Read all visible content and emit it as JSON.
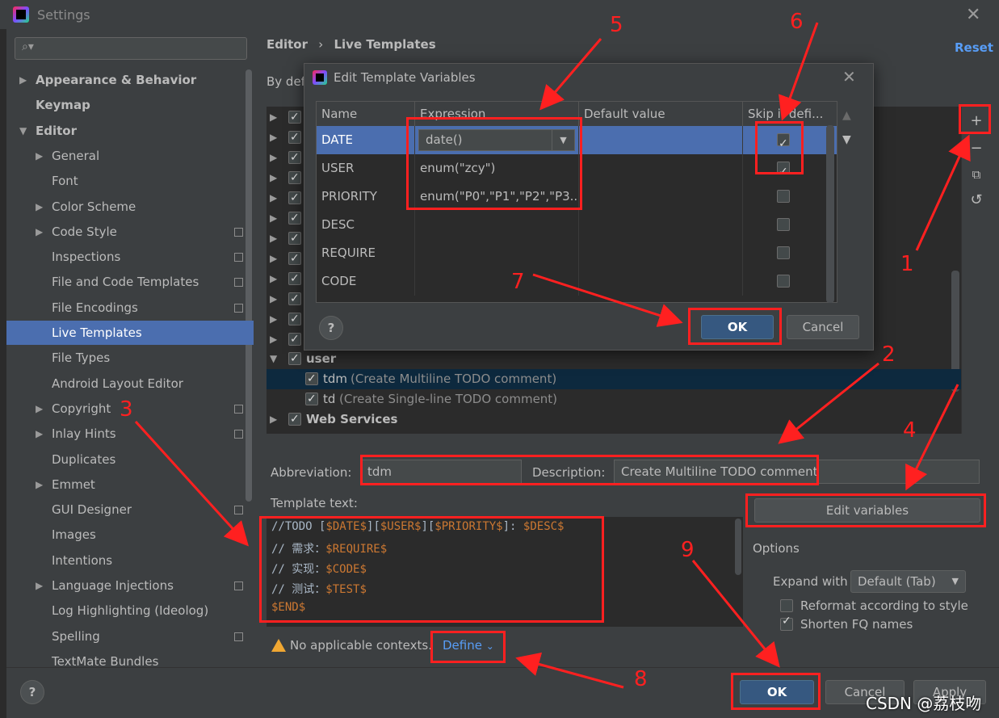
{
  "window": {
    "title": "Settings"
  },
  "sidebar": {
    "search_placeholder": "",
    "items": [
      {
        "label": "Appearance & Behavior",
        "bold": true,
        "arrow": "▶"
      },
      {
        "label": "Keymap",
        "bold": true,
        "arrow": ""
      },
      {
        "label": "Editor",
        "bold": true,
        "arrow": "▼"
      },
      {
        "label": "General",
        "arrow": "▶"
      },
      {
        "label": "Font",
        "arrow": ""
      },
      {
        "label": "Color Scheme",
        "arrow": "▶"
      },
      {
        "label": "Code Style",
        "arrow": "▶",
        "proj": true
      },
      {
        "label": "Inspections",
        "arrow": "",
        "proj": true
      },
      {
        "label": "File and Code Templates",
        "arrow": "",
        "proj": true
      },
      {
        "label": "File Encodings",
        "arrow": "",
        "proj": true
      },
      {
        "label": "Live Templates",
        "arrow": "",
        "selected": true
      },
      {
        "label": "File Types",
        "arrow": ""
      },
      {
        "label": "Android Layout Editor",
        "arrow": ""
      },
      {
        "label": "Copyright",
        "arrow": "▶",
        "proj": true
      },
      {
        "label": "Inlay Hints",
        "arrow": "▶",
        "proj": true
      },
      {
        "label": "Duplicates",
        "arrow": ""
      },
      {
        "label": "Emmet",
        "arrow": "▶"
      },
      {
        "label": "GUI Designer",
        "arrow": "",
        "proj": true
      },
      {
        "label": "Images",
        "arrow": ""
      },
      {
        "label": "Intentions",
        "arrow": ""
      },
      {
        "label": "Language Injections",
        "arrow": "▶",
        "proj": true
      },
      {
        "label": "Log Highlighting (Ideolog)",
        "arrow": ""
      },
      {
        "label": "Spelling",
        "arrow": "",
        "proj": true
      },
      {
        "label": "TextMate Bundles",
        "arrow": ""
      }
    ]
  },
  "main": {
    "breadcrumb_root": "Editor",
    "breadcrumb_sep": "›",
    "breadcrumb_leaf": "Live Templates",
    "reset": "Reset",
    "by_default": "By def",
    "toolbar": {
      "add": "+",
      "remove": "−",
      "copy": "⧉",
      "restore": "↺"
    },
    "groups": [
      {
        "label": "user",
        "expanded": true
      },
      {
        "label": "Web Services",
        "expanded": false
      }
    ],
    "templates": [
      {
        "abbr": "tdm",
        "desc": "(Create Multiline TODO comment)"
      },
      {
        "abbr": "td",
        "desc": "(Create Single-line TODO comment)"
      }
    ],
    "abbreviation_label": "Abbreviation:",
    "abbreviation_value": "tdm",
    "description_label": "Description:",
    "description_value": "Create Multiline TODO comment",
    "template_text_label": "Template text:",
    "template_lines": [
      [
        {
          "t": "//TODO ["
        },
        {
          "t": "$DATE$",
          "v": true
        },
        {
          "t": "]["
        },
        {
          "t": "$USER$",
          "v": true
        },
        {
          "t": "]["
        },
        {
          "t": "$PRIORITY$",
          "v": true
        },
        {
          "t": "]: "
        },
        {
          "t": "$DESC$",
          "v": true
        }
      ],
      [
        {
          "t": "// 需求："
        },
        {
          "t": "$REQUIRE$",
          "v": true
        }
      ],
      [
        {
          "t": "// 实现："
        },
        {
          "t": "$CODE$",
          "v": true
        }
      ],
      [
        {
          "t": "// 测试："
        },
        {
          "t": "$TEST$",
          "v": true
        }
      ],
      [
        {
          "t": "$END$",
          "v": true
        }
      ]
    ],
    "edit_variables": "Edit variables",
    "options_label": "Options",
    "expand_with_label": "Expand with",
    "expand_with_value": "Default (Tab)",
    "reformat_label": "Reformat according to style",
    "shorten_label": "Shorten FQ names",
    "contexts_warning": "No applicable contexts.",
    "define": "Define",
    "chevron": "⌄"
  },
  "footer": {
    "help": "?",
    "ok": "OK",
    "cancel": "Cancel",
    "apply": "Apply"
  },
  "dialog": {
    "title": "Edit Template Variables",
    "columns": [
      "Name",
      "Expression",
      "Default value",
      "Skip if defi..."
    ],
    "rows": [
      {
        "name": "DATE",
        "expression": "date()",
        "default": "",
        "skip": true,
        "selected": true
      },
      {
        "name": "USER",
        "expression": "enum(\"zcy\")",
        "default": "",
        "skip": true
      },
      {
        "name": "PRIORITY",
        "expression": "enum(\"P0\",\"P1\",\"P2\",\"P3...",
        "default": "",
        "skip": false
      },
      {
        "name": "DESC",
        "expression": "",
        "default": "",
        "skip": false
      },
      {
        "name": "REQUIRE",
        "expression": "",
        "default": "",
        "skip": false
      },
      {
        "name": "CODE",
        "expression": "",
        "default": "",
        "skip": false
      }
    ],
    "help": "?",
    "ok": "OK",
    "cancel": "Cancel"
  },
  "annotations": [
    "1",
    "2",
    "3",
    "4",
    "5",
    "6",
    "7",
    "8",
    "9"
  ],
  "watermark": "CSDN @荔枝吻",
  "colors": {
    "selection": "#4b6eaf",
    "accent_link": "#589df6",
    "annotation": "#ff2020",
    "primary_button": "#365880"
  }
}
